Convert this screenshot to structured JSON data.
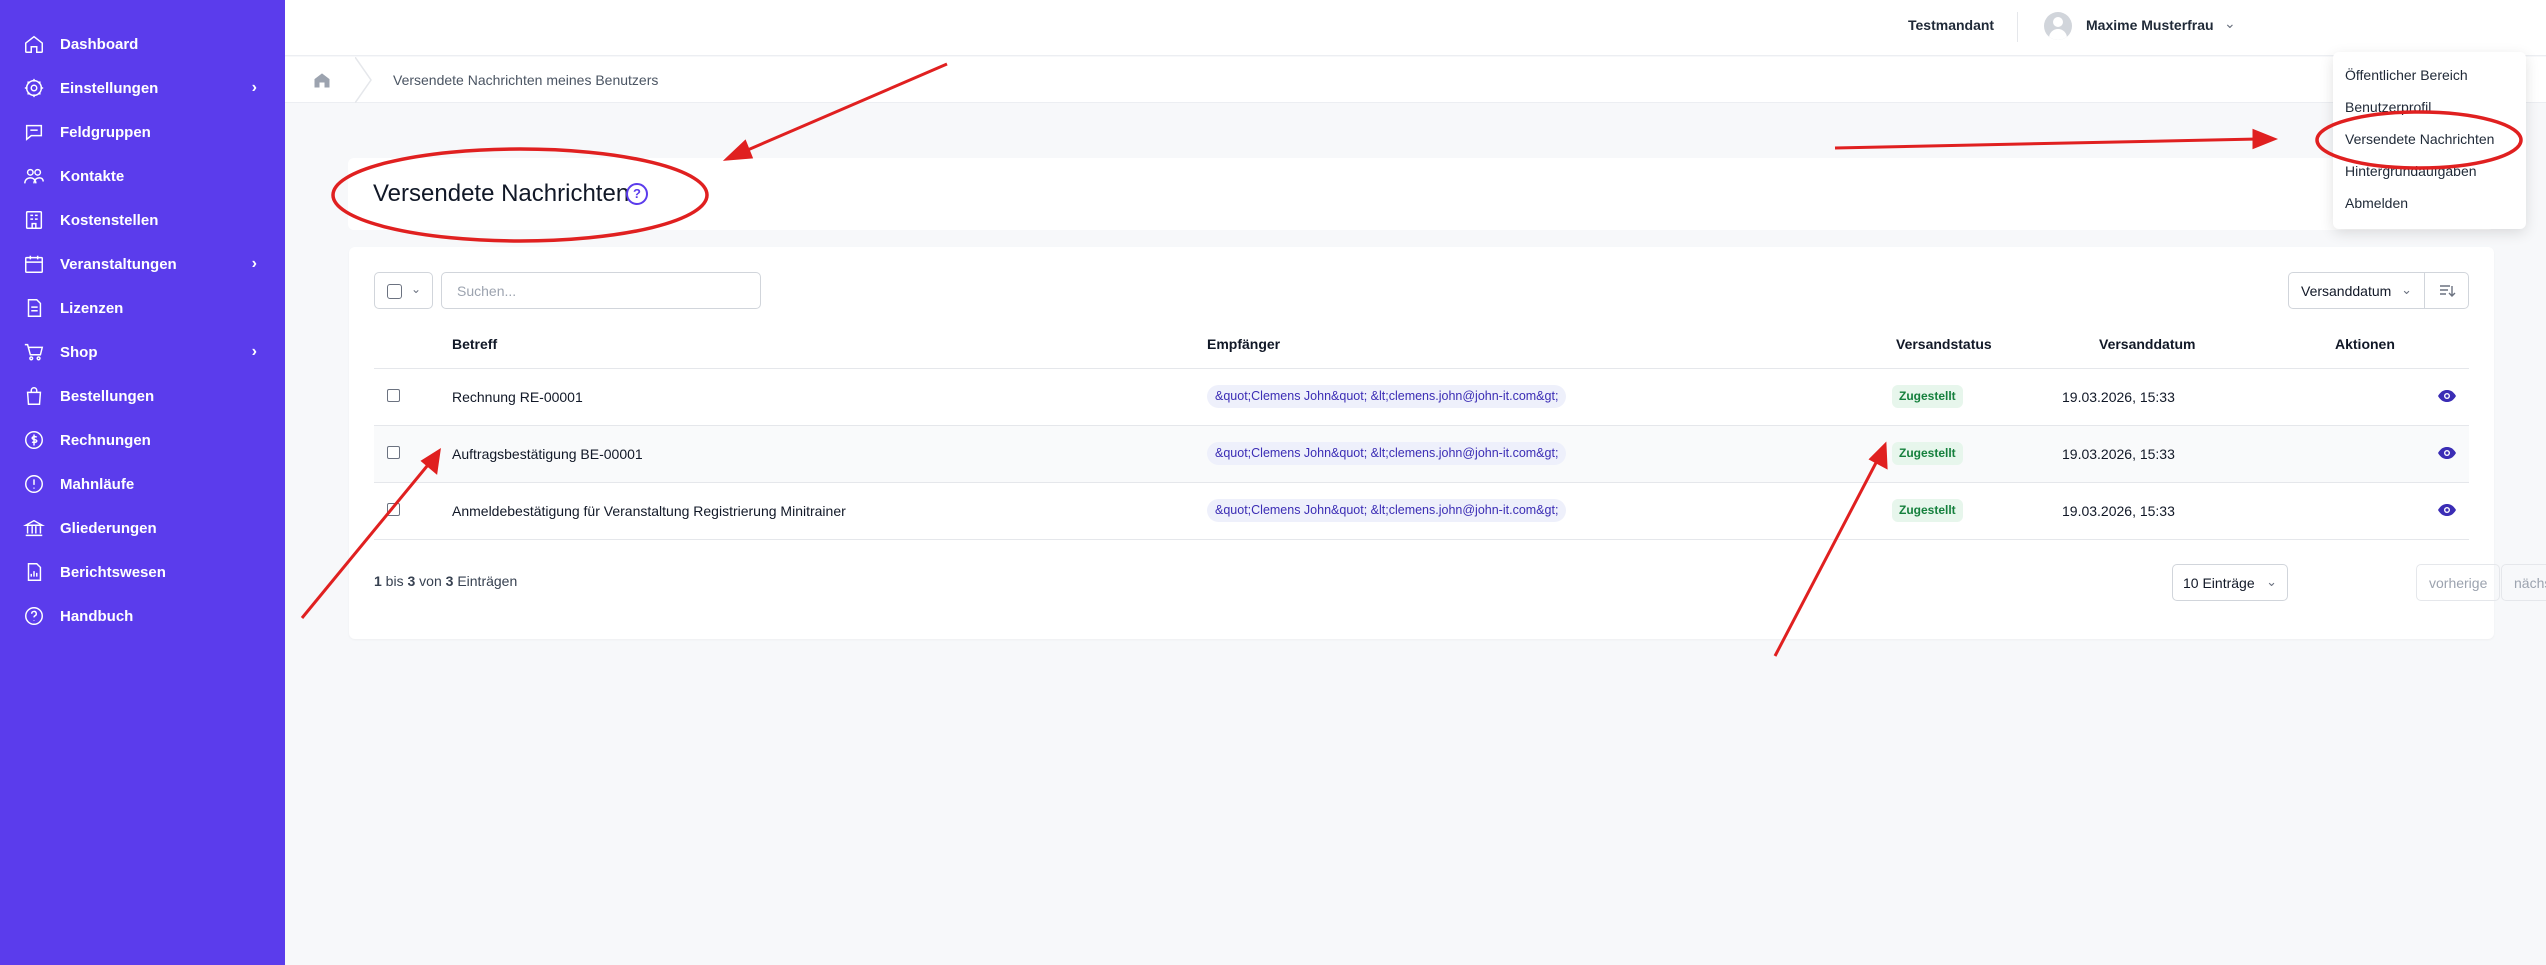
{
  "sidebar": {
    "items": [
      {
        "label": "Dashboard",
        "icon": "home-icon",
        "has_children": false
      },
      {
        "label": "Einstellungen",
        "icon": "gear-icon",
        "has_children": true
      },
      {
        "label": "Feldgruppen",
        "icon": "chat-bubble-icon",
        "has_children": false
      },
      {
        "label": "Kontakte",
        "icon": "users-icon",
        "has_children": false
      },
      {
        "label": "Kostenstellen",
        "icon": "building-icon",
        "has_children": false
      },
      {
        "label": "Veranstaltungen",
        "icon": "calendar-icon",
        "has_children": true
      },
      {
        "label": "Lizenzen",
        "icon": "document-icon",
        "has_children": false
      },
      {
        "label": "Shop",
        "icon": "cart-icon",
        "has_children": true
      },
      {
        "label": "Bestellungen",
        "icon": "bag-icon",
        "has_children": false
      },
      {
        "label": "Rechnungen",
        "icon": "dollar-circle-icon",
        "has_children": false
      },
      {
        "label": "Mahnläufe",
        "icon": "alert-circle-icon",
        "has_children": false
      },
      {
        "label": "Gliederungen",
        "icon": "bank-icon",
        "has_children": false
      },
      {
        "label": "Berichtswesen",
        "icon": "chart-document-icon",
        "has_children": false
      },
      {
        "label": "Handbuch",
        "icon": "help-circle-icon",
        "has_children": false
      }
    ]
  },
  "topbar": {
    "tenant": "Testmandant",
    "username": "Maxime Musterfrau"
  },
  "user_menu": {
    "items": [
      "Öffentlicher Bereich",
      "Benutzerprofil",
      "Versendete Nachrichten",
      "Hintergrundaufgaben",
      "Abmelden"
    ]
  },
  "breadcrumb": {
    "current": "Versendete Nachrichten meines Benutzers"
  },
  "page": {
    "title": "Versendete Nachrichten"
  },
  "table": {
    "search_placeholder": "Suchen...",
    "sort_field": "Versanddatum",
    "columns": {
      "subject": "Betreff",
      "recipient": "Empfänger",
      "status": "Versandstatus",
      "date": "Versanddatum",
      "actions": "Aktionen"
    },
    "rows": [
      {
        "subject": "Rechnung RE-00001",
        "recipient": "&quot;Clemens John&quot; &lt;clemens.john@john-it.com&gt;",
        "status": "Zugestellt",
        "date": "19.03.2026, 15:33"
      },
      {
        "subject": "Auftragsbestätigung BE-00001",
        "recipient": "&quot;Clemens John&quot; &lt;clemens.john@john-it.com&gt;",
        "status": "Zugestellt",
        "date": "19.03.2026, 15:33"
      },
      {
        "subject": "Anmeldebestätigung für Veranstaltung Registrierung Minitrainer",
        "recipient": "&quot;Clemens John&quot; &lt;clemens.john@john-it.com&gt;",
        "status": "Zugestellt",
        "date": "19.03.2026, 15:33"
      }
    ],
    "info": {
      "from": "1",
      "mid1": " bis ",
      "to": "3",
      "mid2": " von ",
      "total": "3",
      "suffix": " Einträgen"
    },
    "page_size": "10 Einträge",
    "prev": "vorherige",
    "next": "nächste"
  },
  "colors": {
    "sidebar": "#5b3cec",
    "accent": "#5b3cec",
    "annotation": "#e02020",
    "status_bg": "#e7f6ec",
    "status_text": "#15803d"
  }
}
